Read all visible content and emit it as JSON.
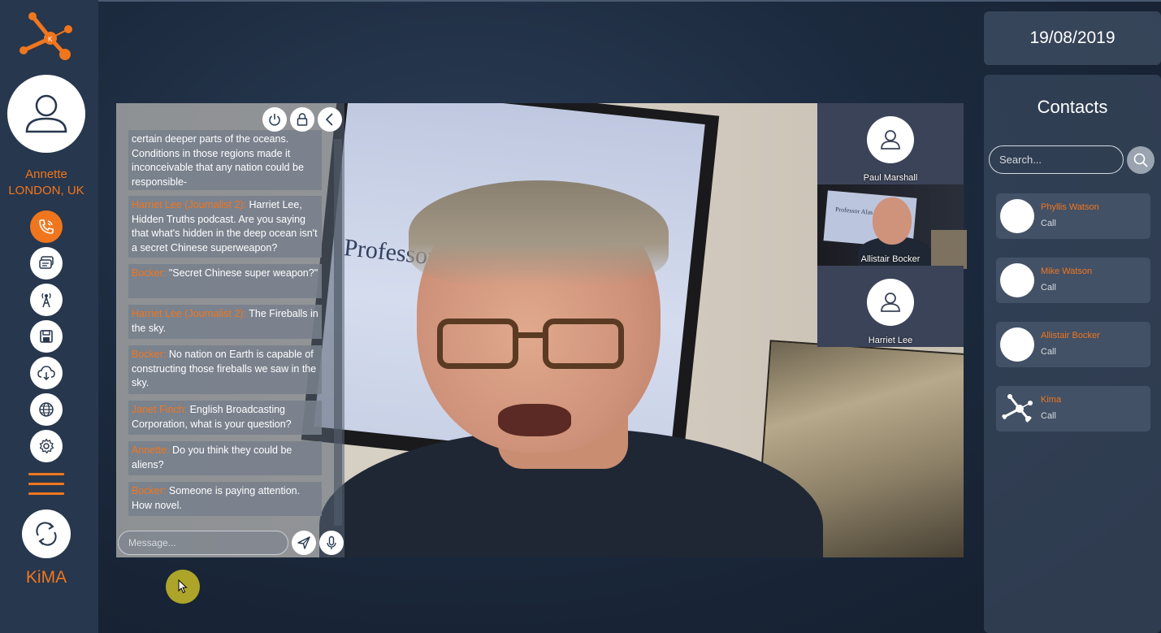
{
  "user": {
    "name": "Annette",
    "location": "LONDON, UK"
  },
  "brand": "KiMA",
  "nav": [
    {
      "icon": "phone-icon",
      "active": true
    },
    {
      "icon": "chat-icon",
      "active": false
    },
    {
      "icon": "antenna-icon",
      "active": false
    },
    {
      "icon": "save-icon",
      "active": false
    },
    {
      "icon": "cloud-icon",
      "active": false
    },
    {
      "icon": "globe-icon",
      "active": false
    },
    {
      "icon": "settings-icon",
      "active": false
    }
  ],
  "chat": {
    "messages": [
      {
        "who": "",
        "text": "certain deeper parts of the oceans. Conditions in those regions made it inconceivable that any nation could be responsible-"
      },
      {
        "who": "Harriet Lee (Journalist 2):",
        "text": " Harriet Lee, Hidden Truths podcast.  Are you saying that what's hidden in the deep ocean isn't a secret Chinese superweapon?"
      },
      {
        "who": "Bocker:",
        "text": " \"Secret Chinese super weapon?\""
      },
      {
        "who": "Harriet Lee (Journalist 2):",
        "text": " The Fireballs in the sky."
      },
      {
        "who": "Bocker:",
        "text": " No nation on Earth is capable of constructing those fireballs we saw in the sky."
      },
      {
        "who": "Janet Finch:",
        "text": " English Broadcasting Corporation, what is your question?"
      },
      {
        "who": "Annette:",
        "text": " Do you think they could be aliens?"
      },
      {
        "who": "Bocker:",
        "text": " Someone is paying attention. How novel."
      }
    ],
    "input_placeholder": "Message..."
  },
  "video": {
    "slide_text": "Professor Alas"
  },
  "participants": [
    {
      "name": "Paul Marshall"
    },
    {
      "name": "Allistair Bocker",
      "mini_slide": "Professor Alas"
    },
    {
      "name": "Harriet Lee"
    }
  ],
  "date": "19/08/2019",
  "contacts": {
    "title": "Contacts",
    "search_placeholder": "Search...",
    "items": [
      {
        "name": "Phyllis Watson",
        "action": "Call"
      },
      {
        "name": "Mike Watson",
        "action": "Call"
      },
      {
        "name": "Allistair Bocker",
        "action": "Call"
      },
      {
        "name": "Kima",
        "action": "Call"
      }
    ]
  },
  "colors": {
    "accent": "#f0761e",
    "sidebar": "#27374d"
  }
}
